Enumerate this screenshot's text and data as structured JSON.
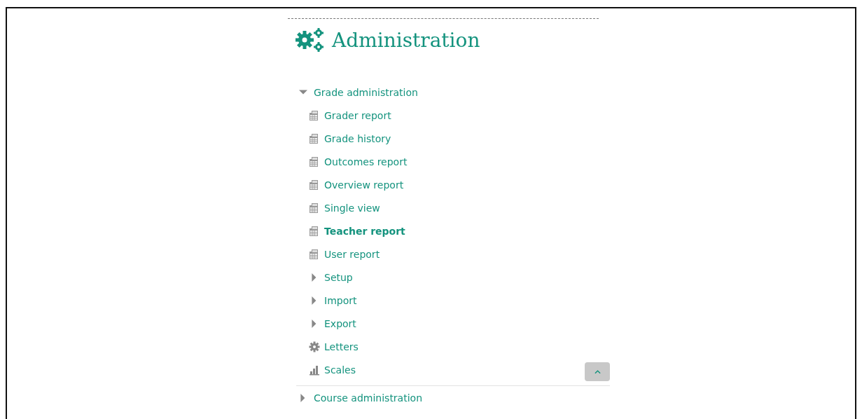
{
  "block": {
    "title": "Administration"
  },
  "tree": [
    {
      "label": "Grade administration",
      "kind": "branch",
      "expanded": true,
      "selected": false,
      "children": [
        {
          "label": "Grader report",
          "kind": "report",
          "selected": false
        },
        {
          "label": "Grade history",
          "kind": "report",
          "selected": false
        },
        {
          "label": "Outcomes report",
          "kind": "report",
          "selected": false
        },
        {
          "label": "Overview report",
          "kind": "report",
          "selected": false
        },
        {
          "label": "Single view",
          "kind": "report",
          "selected": false
        },
        {
          "label": "Teacher report",
          "kind": "report",
          "selected": true
        },
        {
          "label": "User report",
          "kind": "report",
          "selected": false
        },
        {
          "label": "Setup",
          "kind": "branch",
          "expanded": false,
          "selected": false
        },
        {
          "label": "Import",
          "kind": "branch",
          "expanded": false,
          "selected": false
        },
        {
          "label": "Export",
          "kind": "branch",
          "expanded": false,
          "selected": false
        },
        {
          "label": "Letters",
          "kind": "settings",
          "selected": false
        },
        {
          "label": "Scales",
          "kind": "scales",
          "selected": false
        }
      ]
    },
    {
      "label": "Course administration",
      "kind": "branch",
      "expanded": false,
      "selected": false
    }
  ]
}
